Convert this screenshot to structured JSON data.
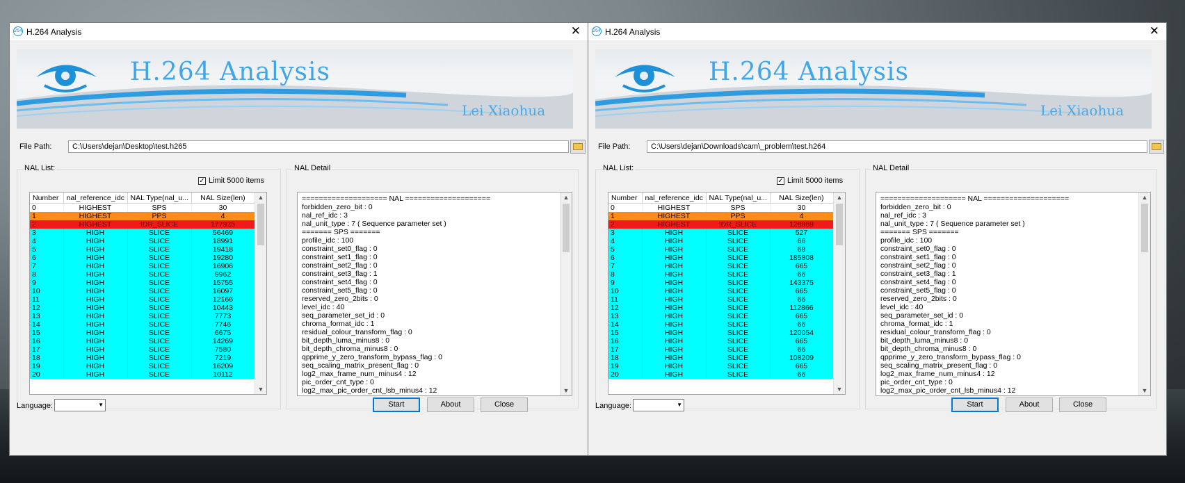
{
  "windows": [
    {
      "title": "H.264 Analysis",
      "banner": {
        "title": "H.264 Analysis",
        "author": "Lei Xiaohua"
      },
      "file_path_label": "File Path:",
      "file_path": "C:\\Users\\dejan\\Desktop\\test.h265",
      "nal_list_label": "NAL List:",
      "limit_label": "Limit 5000 items",
      "limit_checked": true,
      "columns": [
        "Number",
        "nal_reference_idc",
        "NAL Type(nal_u...",
        "NAL Size(len)"
      ],
      "rows": [
        [
          "0",
          "HIGHEST",
          "SPS",
          "30"
        ],
        [
          "1",
          "HIGHEST",
          "PPS",
          "4"
        ],
        [
          "2",
          "HIGHEST",
          "IDR_SLICE",
          "177925"
        ],
        [
          "3",
          "HIGH",
          "SLICE",
          "56469"
        ],
        [
          "4",
          "HIGH",
          "SLICE",
          "18991"
        ],
        [
          "5",
          "HIGH",
          "SLICE",
          "19418"
        ],
        [
          "6",
          "HIGH",
          "SLICE",
          "19280"
        ],
        [
          "7",
          "HIGH",
          "SLICE",
          "16906"
        ],
        [
          "8",
          "HIGH",
          "SLICE",
          "9962"
        ],
        [
          "9",
          "HIGH",
          "SLICE",
          "15755"
        ],
        [
          "10",
          "HIGH",
          "SLICE",
          "16097"
        ],
        [
          "11",
          "HIGH",
          "SLICE",
          "12166"
        ],
        [
          "12",
          "HIGH",
          "SLICE",
          "10443"
        ],
        [
          "13",
          "HIGH",
          "SLICE",
          "7773"
        ],
        [
          "14",
          "HIGH",
          "SLICE",
          "7746"
        ],
        [
          "15",
          "HIGH",
          "SLICE",
          "6675"
        ],
        [
          "16",
          "HIGH",
          "SLICE",
          "14269"
        ],
        [
          "17",
          "HIGH",
          "SLICE",
          "7580"
        ],
        [
          "18",
          "HIGH",
          "SLICE",
          "7219"
        ],
        [
          "19",
          "HIGH",
          "SLICE",
          "16209"
        ],
        [
          "20",
          "HIGH",
          "SLICE",
          "10112"
        ]
      ],
      "nal_detail_label": "NAL Detail",
      "detail": [
        "==================== NAL ====================",
        "forbidden_zero_bit : 0",
        "nal_ref_idc : 3",
        "nal_unit_type : 7 ( Sequence parameter set )",
        "======= SPS =======",
        "profile_idc : 100",
        "constraint_set0_flag : 0",
        "constraint_set1_flag : 0",
        "constraint_set2_flag : 0",
        "constraint_set3_flag : 1",
        "constraint_set4_flag : 0",
        "constraint_set5_flag : 0",
        "reserved_zero_2bits : 0",
        "level_idc : 40",
        "seq_parameter_set_id : 0",
        "chroma_format_idc : 1",
        "residual_colour_transform_flag : 0",
        "bit_depth_luma_minus8 : 0",
        "bit_depth_chroma_minus8 : 0",
        "qpprime_y_zero_transform_bypass_flag : 0",
        "seq_scaling_matrix_present_flag : 0",
        "log2_max_frame_num_minus4 : 12",
        "pic_order_cnt_type : 0",
        "  log2_max_pic_order_cnt_lsb_minus4 : 12"
      ],
      "language_label": "Language:",
      "language_value": "",
      "buttons": {
        "start": "Start",
        "about": "About",
        "close": "Close"
      }
    },
    {
      "title": "H.264 Analysis",
      "banner": {
        "title": "H.264 Analysis",
        "author": "Lei Xiaohua"
      },
      "file_path_label": "File Path:",
      "file_path": "C:\\Users\\dejan\\Downloads\\cam\\_problem\\test.h264",
      "nal_list_label": "NAL List:",
      "limit_label": "Limit 5000 items",
      "limit_checked": true,
      "columns": [
        "Number",
        "nal_reference_idc",
        "NAL Type(nal_u...",
        "NAL Size(len)"
      ],
      "rows": [
        [
          "0",
          "HIGHEST",
          "SPS",
          "30"
        ],
        [
          "1",
          "HIGHEST",
          "PPS",
          "4"
        ],
        [
          "2",
          "HIGHEST",
          "IDR_SLICE",
          "128869"
        ],
        [
          "3",
          "HIGH",
          "SLICE",
          "527"
        ],
        [
          "4",
          "HIGH",
          "SLICE",
          "66"
        ],
        [
          "5",
          "HIGH",
          "SLICE",
          "68"
        ],
        [
          "6",
          "HIGH",
          "SLICE",
          "185808"
        ],
        [
          "7",
          "HIGH",
          "SLICE",
          "665"
        ],
        [
          "8",
          "HIGH",
          "SLICE",
          "66"
        ],
        [
          "9",
          "HIGH",
          "SLICE",
          "143375"
        ],
        [
          "10",
          "HIGH",
          "SLICE",
          "665"
        ],
        [
          "11",
          "HIGH",
          "SLICE",
          "66"
        ],
        [
          "12",
          "HIGH",
          "SLICE",
          "112866"
        ],
        [
          "13",
          "HIGH",
          "SLICE",
          "665"
        ],
        [
          "14",
          "HIGH",
          "SLICE",
          "66"
        ],
        [
          "15",
          "HIGH",
          "SLICE",
          "120054"
        ],
        [
          "16",
          "HIGH",
          "SLICE",
          "665"
        ],
        [
          "17",
          "HIGH",
          "SLICE",
          "66"
        ],
        [
          "18",
          "HIGH",
          "SLICE",
          "108209"
        ],
        [
          "19",
          "HIGH",
          "SLICE",
          "665"
        ],
        [
          "20",
          "HIGH",
          "SLICE",
          "66"
        ]
      ],
      "nal_detail_label": "NAL Detail",
      "detail": [
        "==================== NAL ====================",
        "forbidden_zero_bit : 0",
        "nal_ref_idc : 3",
        "nal_unit_type : 7 ( Sequence parameter set )",
        "======= SPS =======",
        "profile_idc : 100",
        "constraint_set0_flag : 0",
        "constraint_set1_flag : 0",
        "constraint_set2_flag : 0",
        "constraint_set3_flag : 1",
        "constraint_set4_flag : 0",
        "constraint_set5_flag : 0",
        "reserved_zero_2bits : 0",
        "level_idc : 40",
        "seq_parameter_set_id : 0",
        "chroma_format_idc : 1",
        "residual_colour_transform_flag : 0",
        "bit_depth_luma_minus8 : 0",
        "bit_depth_chroma_minus8 : 0",
        "qpprime_y_zero_transform_bypass_flag : 0",
        "seq_scaling_matrix_present_flag : 0",
        "log2_max_frame_num_minus4 : 12",
        "pic_order_cnt_type : 0",
        "  log2_max_pic_order_cnt_lsb_minus4 : 12"
      ],
      "language_label": "Language:",
      "language_value": "",
      "buttons": {
        "start": "Start",
        "about": "About",
        "close": "Close"
      }
    }
  ],
  "row_colors": {
    "SPS": "#ffffff",
    "PPS": "#ff8c1a",
    "IDR_SLICE": "#f01a1a",
    "SLICE": "#00ffff"
  },
  "icons": {
    "app": "h264-logo-icon",
    "close": "close-icon",
    "browse": "folder-open-icon",
    "dropdown": "chevron-down-icon"
  }
}
